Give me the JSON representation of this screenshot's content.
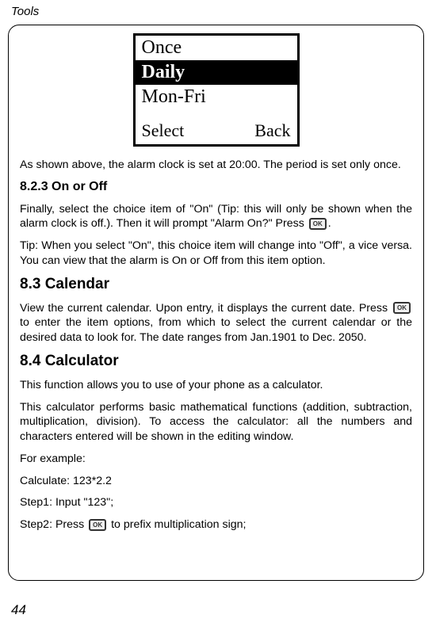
{
  "header": "Tools",
  "phone_screen": {
    "row1": "Once",
    "row2": "Daily",
    "row3": "Mon-Fri",
    "soft_left": "Select",
    "soft_right": "Back"
  },
  "p1": "As shown above, the alarm clock is set at 20:00. The period is set only once.",
  "h823": "8.2.3 On or Off",
  "p823a_part1": "Finally, select the choice item of \"On\" (Tip: this will only be shown when the alarm clock is off.). Then it will prompt \"Alarm On?\"    Press ",
  "p823a_part2": ".",
  "ok_label": "OK",
  "p823b": "Tip:    When you select \"On\", this choice item will change into \"Off\", a vice versa. You can view that the alarm is On or Off from this item option.",
  "h83": "8.3 Calendar",
  "p83a_part1": "View the current calendar. Upon entry, it displays the current date.    Press ",
  "p83a_part2": " to enter the item options, from which to select the current calendar or the desired data to look for. The date ranges from Jan.1901 to Dec. 2050.",
  "h84": "8.4 Calculator",
  "p84a": "This function allows you to use of your phone as a calculator.",
  "p84b": "This calculator performs basic mathematical functions (addition, subtraction, multiplication, division).  To access the calculator: all the numbers and characters entered will be shown in the editing window.",
  "p84c": "For example:",
  "p84d": "Calculate: 123*2.2",
  "p84e": "Step1: Input \"123\";",
  "p84f_part1": "Step2: Press ",
  "p84f_part2": " to prefix multiplication sign;",
  "page_number": "44"
}
